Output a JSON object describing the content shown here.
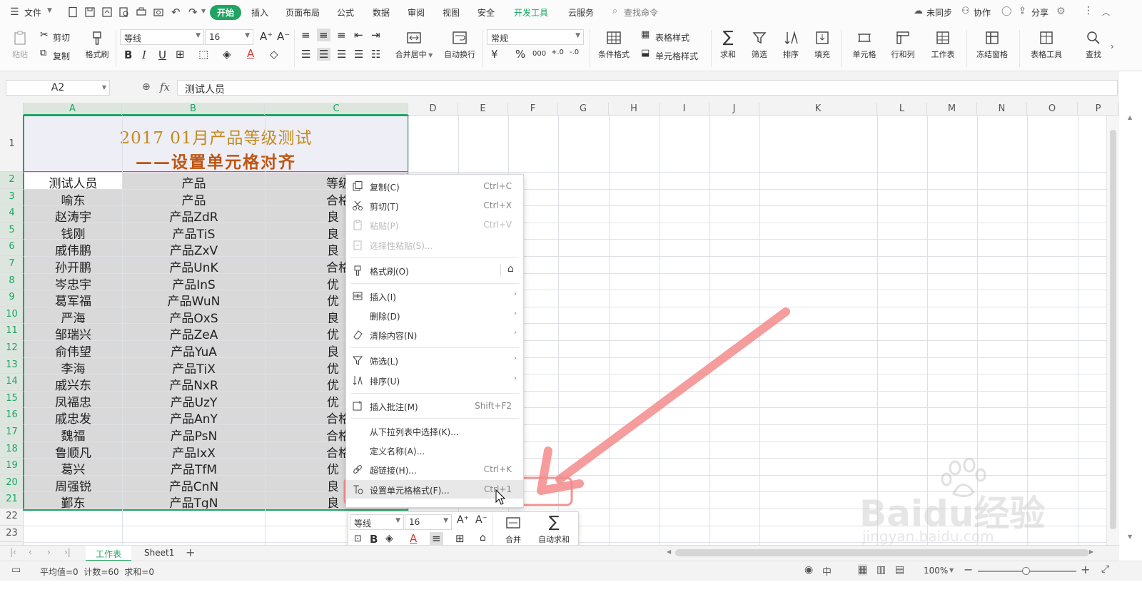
{
  "menubar": {
    "file_label": "文件",
    "tabs": [
      {
        "label": "开始",
        "active": true
      },
      {
        "label": "插入"
      },
      {
        "label": "页面布局"
      },
      {
        "label": "公式"
      },
      {
        "label": "数据"
      },
      {
        "label": "审阅"
      },
      {
        "label": "视图"
      },
      {
        "label": "安全"
      },
      {
        "label": "开发工具",
        "highlight": true
      },
      {
        "label": "云服务"
      }
    ],
    "search_placeholder": "查找命令",
    "sync_label": "未同步",
    "collab_label": "协作",
    "share_label": "分享"
  },
  "ribbon": {
    "paste": "粘贴",
    "cut": "剪切",
    "copy": "复制",
    "format_painter": "格式刷",
    "font_name": "等线",
    "font_size": "16",
    "merge_center": "合并居中",
    "wrap_text": "自动换行",
    "number_format": "常规",
    "cond_format": "条件格式",
    "table_style": "表格样式",
    "cell_style": "单元格样式",
    "sum": "求和",
    "filter": "筛选",
    "sort": "排序",
    "fill": "填充",
    "cell": "单元格",
    "row_col": "行和列",
    "worksheet": "工作表",
    "freeze": "冻结窗格",
    "table_tools": "表格工具",
    "find": "查找"
  },
  "formulabar": {
    "cell_ref": "A2",
    "fx": "fx",
    "value": "测试人员"
  },
  "columns": [
    "A",
    "B",
    "C",
    "D",
    "E",
    "F",
    "G",
    "H",
    "I",
    "J",
    "K",
    "L",
    "M",
    "N",
    "O",
    "P"
  ],
  "rows": [
    "1",
    "2",
    "3",
    "4",
    "5",
    "6",
    "7",
    "8",
    "9",
    "10",
    "11",
    "12",
    "13",
    "14",
    "15",
    "16",
    "17",
    "18",
    "19",
    "20",
    "21",
    "22",
    "23"
  ],
  "sheet_title": {
    "line1": "2017 01月产品等级测试",
    "line2": "——设置单元格对齐"
  },
  "table": {
    "headers": [
      "测试人员",
      "产品",
      "等级"
    ],
    "rows": [
      [
        "喻东",
        "产品",
        "合格"
      ],
      [
        "赵涛宇",
        "产品ZdR",
        "良"
      ],
      [
        "钱刚",
        "产品TjS",
        "良"
      ],
      [
        "戚伟鹏",
        "产品ZxV",
        "良"
      ],
      [
        "孙开鹏",
        "产品UnK",
        "合格"
      ],
      [
        "岑忠宇",
        "产品InS",
        "优"
      ],
      [
        "葛军福",
        "产品WuN",
        "优"
      ],
      [
        "严海",
        "产品OxS",
        "良"
      ],
      [
        "邹瑞兴",
        "产品ZeA",
        "优"
      ],
      [
        "俞伟望",
        "产品YuA",
        "良"
      ],
      [
        "李海",
        "产品TjX",
        "优"
      ],
      [
        "戚兴东",
        "产品NxR",
        "优"
      ],
      [
        "凤福忠",
        "产品UzY",
        "优"
      ],
      [
        "戚忠发",
        "产品AnY",
        "合格"
      ],
      [
        "魏福",
        "产品PsN",
        "合格"
      ],
      [
        "鲁顺凡",
        "产品IxX",
        "合格"
      ],
      [
        "葛兴",
        "产品TfM",
        "优"
      ],
      [
        "周强锐",
        "产品CnN",
        "良"
      ],
      [
        "鄞东",
        "产品TgN",
        "良"
      ]
    ]
  },
  "context_menu": {
    "items": [
      {
        "label": "复制(C)",
        "shortcut": "Ctrl+C",
        "icon": "copy-icon"
      },
      {
        "label": "剪切(T)",
        "shortcut": "Ctrl+X",
        "icon": "scissors-icon"
      },
      {
        "label": "粘贴(P)",
        "shortcut": "Ctrl+V",
        "icon": "paste-icon",
        "disabled": true
      },
      {
        "label": "选择性粘贴(S)...",
        "icon": "paste-special-icon",
        "disabled": true
      },
      {
        "label": "格式刷(O)",
        "icon": "brush-icon"
      },
      {
        "label": "插入(I)",
        "icon": "insert-icon",
        "submenu": true
      },
      {
        "label": "删除(D)",
        "submenu": true
      },
      {
        "label": "清除内容(N)",
        "icon": "eraser-icon",
        "submenu": true
      },
      {
        "label": "筛选(L)",
        "icon": "filter-icon",
        "submenu": true
      },
      {
        "label": "排序(U)",
        "icon": "sort-icon",
        "submenu": true
      },
      {
        "label": "插入批注(M)",
        "shortcut": "Shift+F2",
        "icon": "comment-icon"
      },
      {
        "label": "从下拉列表中选择(K)..."
      },
      {
        "label": "定义名称(A)..."
      },
      {
        "label": "超链接(H)...",
        "shortcut": "Ctrl+K",
        "icon": "link-icon"
      },
      {
        "label": "设置单元格格式(F)...",
        "shortcut": "Ctrl+1",
        "icon": "format-cells-icon",
        "hover": true
      }
    ]
  },
  "mini_toolbar": {
    "font_name": "等线",
    "font_size": "16",
    "merge": "合并",
    "autosum": "自动求和"
  },
  "sheets": [
    {
      "label": "工作表",
      "active": true
    },
    {
      "label": "Sheet1"
    }
  ],
  "status": {
    "summary": "平均值=0  计数=60  求和=0",
    "zoom": "100%"
  },
  "watermark": {
    "brand": "Baidu经验",
    "url": "jingyan.baidu.com"
  },
  "colors": {
    "accent": "#1fa463",
    "title_gold": "#c48a1c",
    "title_orange": "#c0540f",
    "highlight_arrow": "#f48b8b"
  }
}
